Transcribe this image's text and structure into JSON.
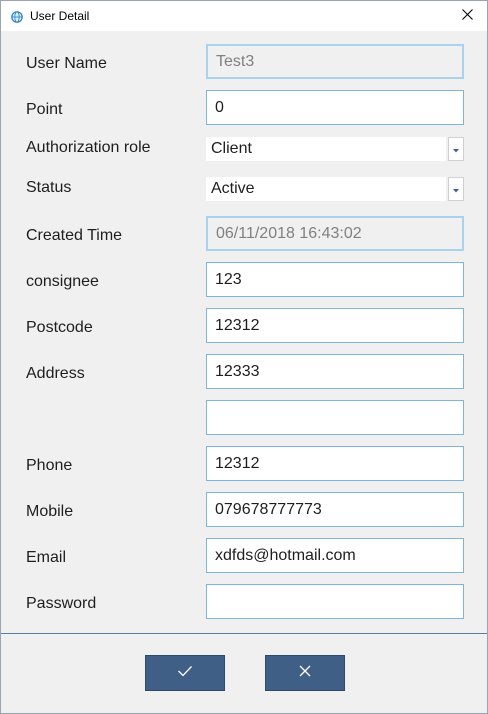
{
  "window": {
    "title": "User Detail",
    "icon": "globe-icon",
    "close_icon": "close-icon"
  },
  "colors": {
    "field_border": "#7fb4dc",
    "button_bg": "#3f5f86",
    "divider": "#5a7da3"
  },
  "form": {
    "username": {
      "label": "User Name",
      "value": "Test3"
    },
    "point": {
      "label": "Point",
      "value": "0"
    },
    "role": {
      "label": "Authorization role",
      "value": "Client"
    },
    "status": {
      "label": "Status",
      "value": "Active"
    },
    "created_time": {
      "label": "Created Time",
      "value": "06/11/2018 16:43:02"
    },
    "consignee": {
      "label": "consignee",
      "value": "123"
    },
    "postcode": {
      "label": "Postcode",
      "value": "12312"
    },
    "address": {
      "label": "Address",
      "value": "12333"
    },
    "address2": {
      "value": ""
    },
    "phone": {
      "label": "Phone",
      "value": "12312"
    },
    "mobile": {
      "label": "Mobile",
      "value": "079678777773"
    },
    "email": {
      "label": "Email",
      "value": "xdfds@hotmail.com"
    },
    "password": {
      "label": "Password",
      "value": ""
    }
  },
  "footer": {
    "ok_icon": "checkmark-icon",
    "cancel_icon": "close-icon"
  }
}
